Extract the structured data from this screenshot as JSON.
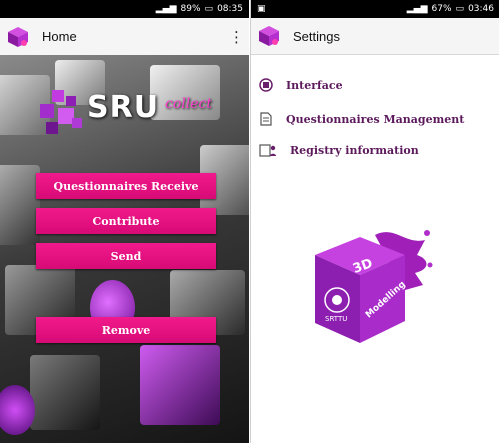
{
  "left_phone": {
    "status": {
      "battery": "89%",
      "time": "08:35"
    },
    "appbar": {
      "title": "Home"
    },
    "logo": {
      "main": "SRU",
      "sub": "collect"
    },
    "buttons": [
      {
        "label": "Questionnaires Receive"
      },
      {
        "label": "Contribute"
      },
      {
        "label": "Send"
      },
      {
        "label": "Remove"
      }
    ]
  },
  "right_phone": {
    "status": {
      "battery": "67%",
      "time": "03:46"
    },
    "appbar": {
      "title": "Settings"
    },
    "menu": [
      {
        "label": "Interface",
        "icon": "theme-icon"
      },
      {
        "label": "Questionnaires Management",
        "icon": "document-icon"
      },
      {
        "label": "Registry information",
        "icon": "registry-icon"
      }
    ],
    "cube_logo": {
      "top_text": "3D",
      "side_text": "Modelling",
      "front_text": "SRTTU"
    }
  },
  "colors": {
    "accent": "#e0117f",
    "purple": "#9b1fb0",
    "menu_text": "#5c1a5c"
  }
}
